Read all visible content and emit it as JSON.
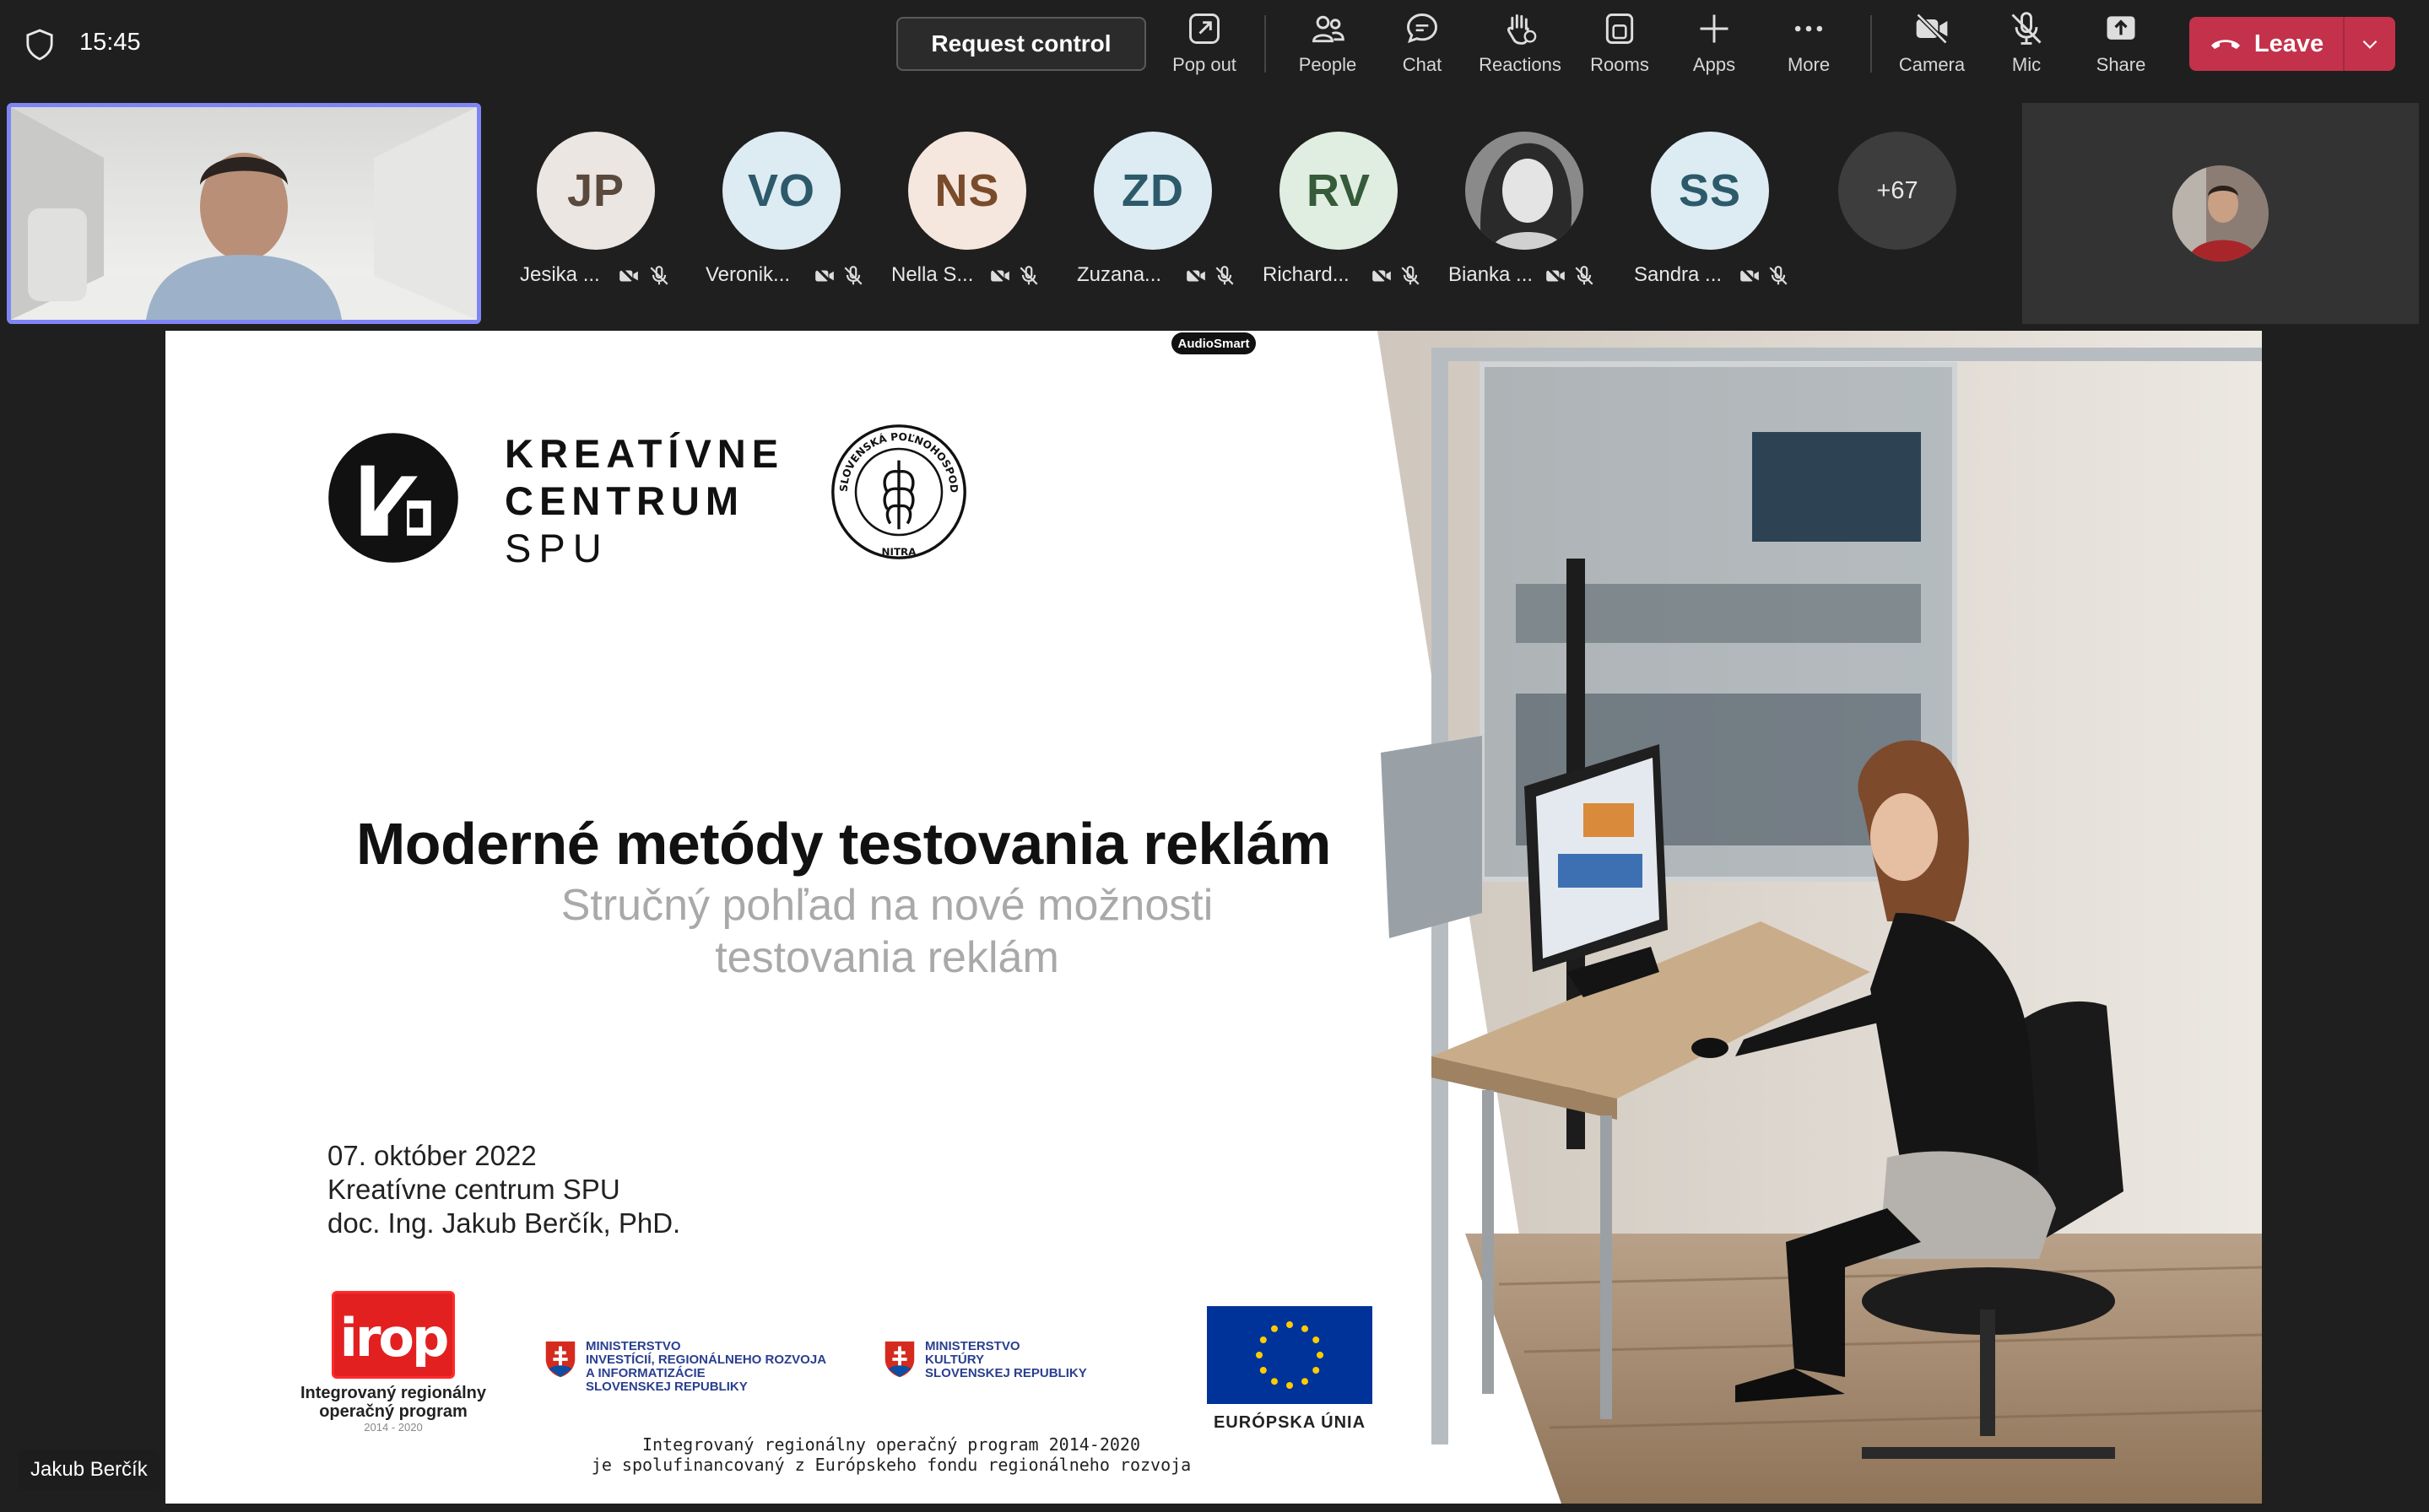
{
  "toolbar": {
    "time": "15:45",
    "request_control": "Request control",
    "pop_out": "Pop out",
    "people": "People",
    "chat": "Chat",
    "reactions": "Reactions",
    "rooms": "Rooms",
    "apps": "Apps",
    "more": "More",
    "camera": "Camera",
    "mic": "Mic",
    "share": "Share",
    "leave": "Leave"
  },
  "participants": [
    {
      "initials": "JP",
      "name": "Jesika ...",
      "bg": "#ece6e2",
      "fg": "#5a4a3e"
    },
    {
      "initials": "VO",
      "name": "Veronik...",
      "bg": "#dcecf2",
      "fg": "#2d5a6b"
    },
    {
      "initials": "NS",
      "name": "Nella S...",
      "bg": "#f6e7de",
      "fg": "#7a4b2b"
    },
    {
      "initials": "ZD",
      "name": "Zuzana...",
      "bg": "#dcecf2",
      "fg": "#2d5a6b"
    },
    {
      "initials": "RV",
      "name": "Richard...",
      "bg": "#dfeee0",
      "fg": "#355b3a"
    },
    {
      "initials": "",
      "name": "Bianka ...",
      "bg": "#777777",
      "fg": "#ffffff"
    },
    {
      "initials": "SS",
      "name": "Sandra ...",
      "bg": "#dcecf2",
      "fg": "#2d5a6b"
    }
  ],
  "overflow_count": "+67",
  "slide": {
    "audiosmart": "AudioSmart",
    "logo_line1": "KREATÍVNE",
    "logo_line2": "CENTRUM",
    "logo_line3": "SPU",
    "seal_text": "SLOVENSKÁ POĽNOHOSPODÁRSKA UNIVERZITA",
    "seal_city": "NITRA",
    "title": "Moderné metódy testovania reklám",
    "subtitle_line1": "Stručný pohľad na nové možnosti",
    "subtitle_line2": "testovania reklám",
    "date": "07. október 2022",
    "venue": "Kreatívne centrum SPU",
    "author": "doc. Ing. Jakub Berčík, PhD.",
    "irop_logo": "irop",
    "irop_line1": "Integrovaný regionálny",
    "irop_line2": "operačný program",
    "irop_years": "2014 - 2020",
    "ministry1_l1": "MINISTERSTVO",
    "ministry1_l2": "INVESTÍCIÍ, REGIONÁLNEHO ROZVOJA",
    "ministry1_l3": "A INFORMATIZÁCIE",
    "ministry1_l4": "SLOVENSKEJ REPUBLIKY",
    "ministry2_l1": "MINISTERSTVO",
    "ministry2_l2": "KULTÚRY",
    "ministry2_l3": "SLOVENSKEJ REPUBLIKY",
    "eu_label": "EURÓPSKA ÚNIA",
    "footer_line1": "Integrovaný regionálny operačný program 2014-2020",
    "footer_line2": "je spolufinancovaný z Európskeho fondu regionálneho rozvoja"
  },
  "presenter_name": "Jakub Berčík"
}
